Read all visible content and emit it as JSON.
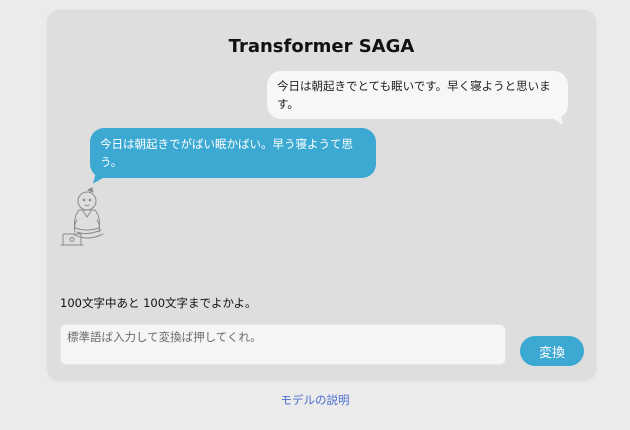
{
  "header": {
    "title": "Transformer SAGA"
  },
  "chat": {
    "user_message": "今日は朝起きでとても眠いです。早く寝ようと思います。",
    "bot_message": "今日は朝起きでがばい眠かばい。早う寝ようて思う。"
  },
  "status": {
    "char_count_text": "100文字中あと 100文字までよかよ。"
  },
  "input": {
    "value": "",
    "placeholder": "標準語ば入力して変換ば押してくれ。"
  },
  "actions": {
    "convert_label": "変換"
  },
  "footer": {
    "model_link": "モデルの説明"
  },
  "colors": {
    "accent": "#3ca9d3",
    "card_bg": "#dedede",
    "page_bg": "#ebebeb",
    "link": "#4a6ed0"
  },
  "icons": {
    "mascot": "samurai-with-laptop-icon"
  }
}
